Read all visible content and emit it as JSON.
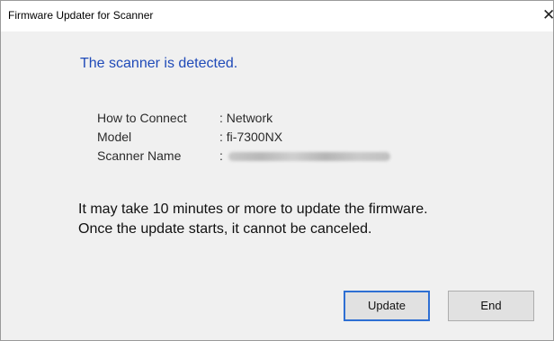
{
  "window": {
    "title": "Firmware Updater for Scanner",
    "close_glyph": "✕"
  },
  "dialog": {
    "heading": "The scanner is detected.",
    "info": [
      {
        "label": "How to Connect",
        "value": ": Network"
      },
      {
        "label": "Model",
        "value": ": fi-7300NX"
      },
      {
        "label": "Scanner Name",
        "value": ":"
      }
    ],
    "message_line1": "It may take 10 minutes or more to update the firmware.",
    "message_line2": "Once the update starts, it cannot be canceled."
  },
  "buttons": {
    "update_label": "Update",
    "end_label": "End"
  },
  "colors": {
    "heading": "#1f4ab8",
    "default_button_border": "#2e6fd3",
    "client_background": "#f0f0f0"
  }
}
